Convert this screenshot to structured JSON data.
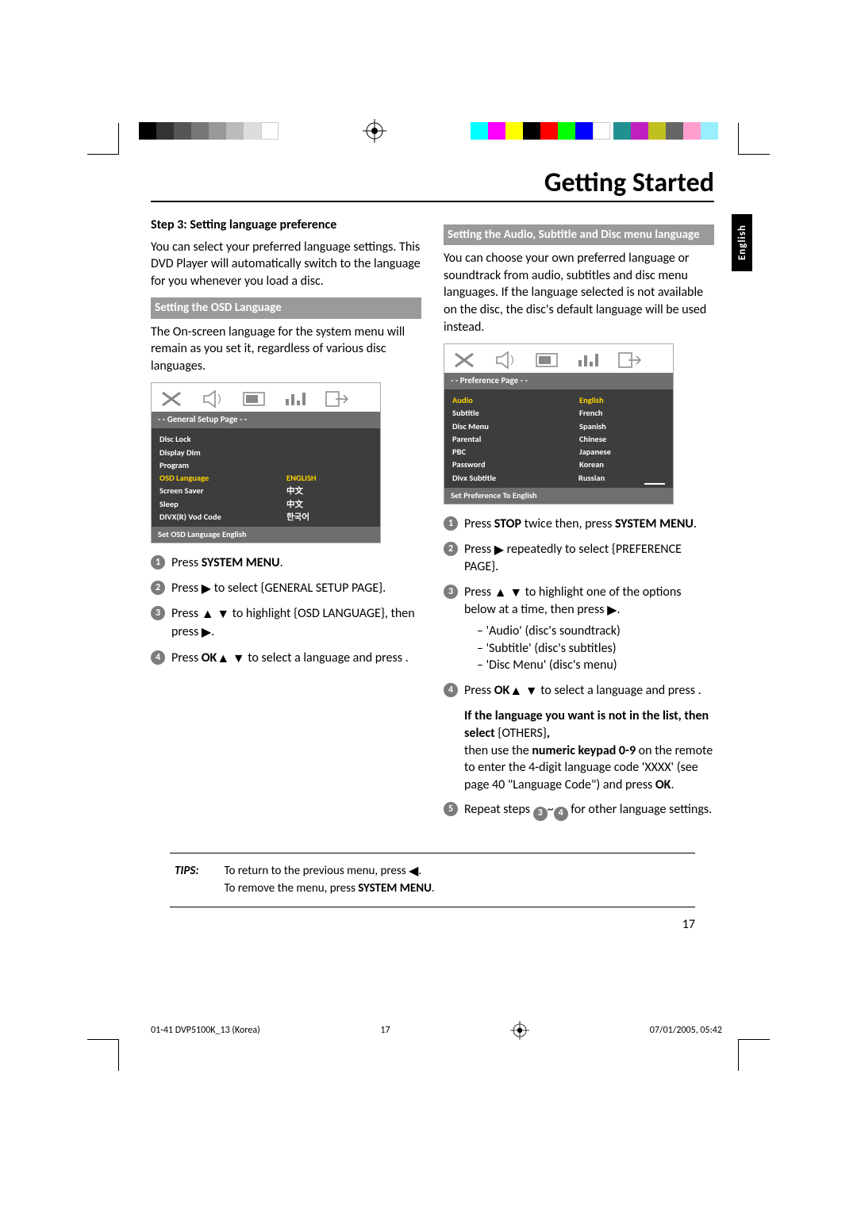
{
  "color_bars": {
    "left": [
      "#000000",
      "#333333",
      "#555555",
      "#777777",
      "#999999",
      "#bbbbbb",
      "#dddddd",
      "#ffffff"
    ],
    "right_a": [
      "#00ffff",
      "#ff00ff",
      "#ffff00",
      "#000000",
      "#ff0000",
      "#00ff00",
      "#0000ff",
      "#ffffff"
    ],
    "right_b": [
      "#209090",
      "#c020c0",
      "#c0c020",
      "#606060",
      "#ff80c0",
      "#80ffff"
    ]
  },
  "page_title": "Getting Started",
  "side_tab": "English",
  "left": {
    "heading": "Step 3:  Setting language preference",
    "intro": "You can select your preferred language settings. This DVD Player will automatically switch to the language for you whenever you load a disc.",
    "sub1_title": "Setting the OSD Language",
    "sub1_body": "The On-screen language for the system menu will remain as you set it, regardless of various disc languages.",
    "osd": {
      "tab": "- -   General Setup Page   - -",
      "rows": [
        {
          "c1": "Disc Lock",
          "c2": ""
        },
        {
          "c1": "Display Dim",
          "c2": ""
        },
        {
          "c1": "Program",
          "c2": ""
        },
        {
          "c1": "OSD Language",
          "c2": "ENGLISH",
          "hl": true
        },
        {
          "c1": "Screen Saver",
          "c2": "中文"
        },
        {
          "c1": "Sleep",
          "c2": "中文"
        },
        {
          "c1": "DIVX(R) Vod Code",
          "c2": "한국어"
        }
      ],
      "foot": "Set OSD Language English"
    },
    "steps": [
      {
        "n": "1",
        "pre": "Press ",
        "bold": "SYSTEM MENU",
        "post": "."
      },
      {
        "n": "2",
        "pre": "Press ",
        "sym": "▶",
        "post": " to select {GENERAL SETUP PAGE}."
      },
      {
        "n": "3",
        "pre": "Press ",
        "sym": "▲ ▼",
        "post": " to highlight {OSD LANGUAGE}, then press ",
        "sym2": "▶",
        "post2": "."
      },
      {
        "n": "4",
        "pre": "Press ",
        "sym": "▲ ▼",
        "post": " to select a language and press ",
        "bold": "OK",
        "post2": "."
      }
    ]
  },
  "right": {
    "sub_title": "Setting the Audio, Subtitle and Disc menu language",
    "body": "You can choose your own preferred language or soundtrack from audio, subtitles and disc menu languages. If the language selected is not available on the disc, the disc's default language will be used instead.",
    "osd": {
      "tab": "- -   Preference Page   - -",
      "rows": [
        {
          "c1": "Audio",
          "c2": "English",
          "hl": true
        },
        {
          "c1": "Subtitle",
          "c2": "French"
        },
        {
          "c1": "Disc Menu",
          "c2": "Spanish"
        },
        {
          "c1": "Parental",
          "c2": "Chinese"
        },
        {
          "c1": "PBC",
          "c2": "Japanese"
        },
        {
          "c1": "Password",
          "c2": "Korean"
        },
        {
          "c1": "Divx Subtitle",
          "c2": "Russian"
        }
      ],
      "foot": "Set Preference To English"
    },
    "steps": [
      {
        "n": "1",
        "pre": "Press ",
        "bold": "STOP",
        "mid": " twice then, press ",
        "bold2": "SYSTEM MENU",
        "post": "."
      },
      {
        "n": "2",
        "pre": "Press ",
        "sym": "▶",
        "post": " repeatedly to select {PREFERENCE PAGE}."
      },
      {
        "n": "3",
        "pre": "Press ",
        "sym": "▲ ▼",
        "post": " to highlight one of the options below at a time, then press ",
        "sym2": "▶",
        "post2": ".",
        "subs": [
          "'Audio' (disc's soundtrack)",
          "'Subtitle' (disc's subtitles)",
          "'Disc Menu' (disc's menu)"
        ]
      },
      {
        "n": "4",
        "pre": "Press ",
        "sym": "▲ ▼",
        "post": " to select a language and press ",
        "bold": "OK",
        "post2": "."
      }
    ],
    "others_lead": "If the language you want is not in the list, then select ",
    "others_val": "{OTHERS}",
    "others_tail_a": "then use the ",
    "others_bold": "numeric keypad 0-9",
    "others_tail_b": " on the remote to enter the 4-digit language code 'XXXX' (see page 40 \"Language Code\") and press ",
    "others_ok": "OK",
    "step5_n": "5",
    "step5": "Repeat steps ",
    "step5_a": "3",
    "step5_tilde": "~",
    "step5_b": "4",
    "step5_tail": " for other language settings."
  },
  "tips": {
    "label": "TIPS:",
    "line1_a": "To return to the previous menu, press ",
    "line1_sym": "◀",
    "line1_b": ".",
    "line2_a": "To remove the menu, press ",
    "line2_bold": "SYSTEM MENU",
    "line2_b": "."
  },
  "page_number": "17",
  "footer": {
    "left": "01-41 DVP5100K_13 (Korea)",
    "center": "17",
    "right": "07/01/2005, 05:42"
  }
}
